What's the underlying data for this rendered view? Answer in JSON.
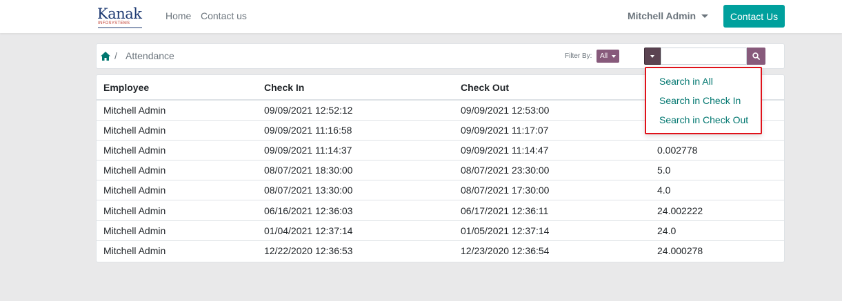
{
  "brand": {
    "logo_text": "Kanak",
    "logo_tagline": "INFOSYSTEMS"
  },
  "nav": {
    "links": [
      "Home",
      "Contact us"
    ],
    "user": "Mitchell Admin",
    "cta_label": "Contact Us"
  },
  "breadcrumb": {
    "separator": "/",
    "title": "Attendance"
  },
  "filter": {
    "label": "Filter By:",
    "selected": "All"
  },
  "search": {
    "value": "",
    "options": [
      "Search in All",
      "Search in Check In",
      "Search in Check Out"
    ]
  },
  "table": {
    "headers": [
      "Employee",
      "Check In",
      "Check Out",
      ""
    ],
    "rows": [
      [
        "Mitchell Admin",
        "09/09/2021 12:52:12",
        "09/09/2021 12:53:00",
        ""
      ],
      [
        "Mitchell Admin",
        "09/09/2021 11:16:58",
        "09/09/2021 11:17:07",
        ""
      ],
      [
        "Mitchell Admin",
        "09/09/2021 11:14:37",
        "09/09/2021 11:14:47",
        "0.002778"
      ],
      [
        "Mitchell Admin",
        "08/07/2021 18:30:00",
        "08/07/2021 23:30:00",
        "5.0"
      ],
      [
        "Mitchell Admin",
        "08/07/2021 13:30:00",
        "08/07/2021 17:30:00",
        "4.0"
      ],
      [
        "Mitchell Admin",
        "06/16/2021 12:36:03",
        "06/17/2021 12:36:11",
        "24.002222"
      ],
      [
        "Mitchell Admin",
        "01/04/2021 12:37:14",
        "01/05/2021 12:37:14",
        "24.0"
      ],
      [
        "Mitchell Admin",
        "12/22/2020 12:36:53",
        "12/23/2020 12:36:54",
        "24.000278"
      ]
    ]
  },
  "colors": {
    "primary": "#875a7b",
    "cta": "#00a09d",
    "link": "#00766f",
    "dropdown_highlight": "#e0121a"
  },
  "icons": {
    "home": "home-icon",
    "search": "search-icon",
    "caret": "caret-down-icon"
  }
}
